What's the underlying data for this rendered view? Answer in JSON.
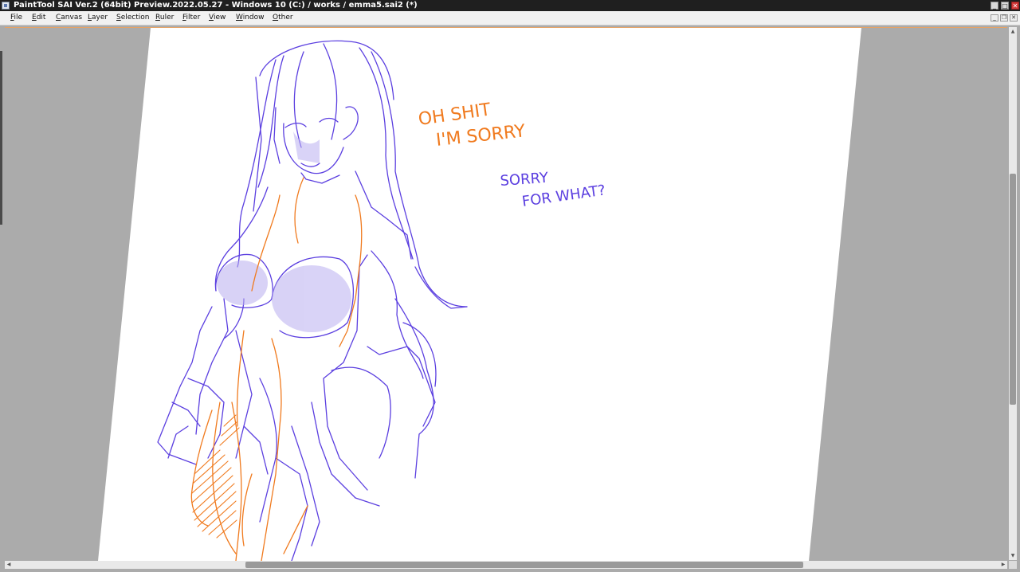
{
  "window": {
    "title": "PaintTool SAI Ver.2 (64bit) Preview.2022.05.27 - Windows 10 (C:) / works / emma5.sai2 (*)",
    "controls": {
      "minimize": "_",
      "maximize": "□",
      "close": "✕"
    }
  },
  "menubar": {
    "items": [
      {
        "label": "File",
        "ul": "F",
        "rest": "ile"
      },
      {
        "label": "Edit",
        "ul": "E",
        "rest": "dit"
      },
      {
        "label": "Canvas",
        "ul": "C",
        "rest": "anvas"
      },
      {
        "label": "Layer",
        "ul": "L",
        "rest": "ayer"
      },
      {
        "label": "Selection",
        "ul": "S",
        "rest": "election"
      },
      {
        "label": "Ruler",
        "ul": "R",
        "rest": "uler"
      },
      {
        "label": "Filter",
        "ul": "F",
        "rest": "ilter"
      },
      {
        "label": "View",
        "ul": "V",
        "rest": "iew"
      },
      {
        "label": "Window",
        "ul": "W",
        "rest": "indow"
      },
      {
        "label": "Other",
        "ul": "O",
        "rest": "ther"
      }
    ],
    "doc_controls": {
      "minimize": "_",
      "restore": "❐",
      "close": "✕"
    }
  },
  "canvas": {
    "colors": {
      "paper": "#ffffff",
      "background": "#ababab",
      "blue_ink": "#5b3fe0",
      "orange_ink": "#f07a1e",
      "shade": "#b9aef0"
    },
    "text_orange_line1": "OH SHIT",
    "text_orange_line2": "I'M SORRY",
    "text_blue_line1": "SORRY",
    "text_blue_line2": "FOR WHAT?"
  },
  "scrollbars": {
    "up_arrow": "▲",
    "down_arrow": "▼",
    "left_arrow": "◀",
    "right_arrow": "▶"
  }
}
